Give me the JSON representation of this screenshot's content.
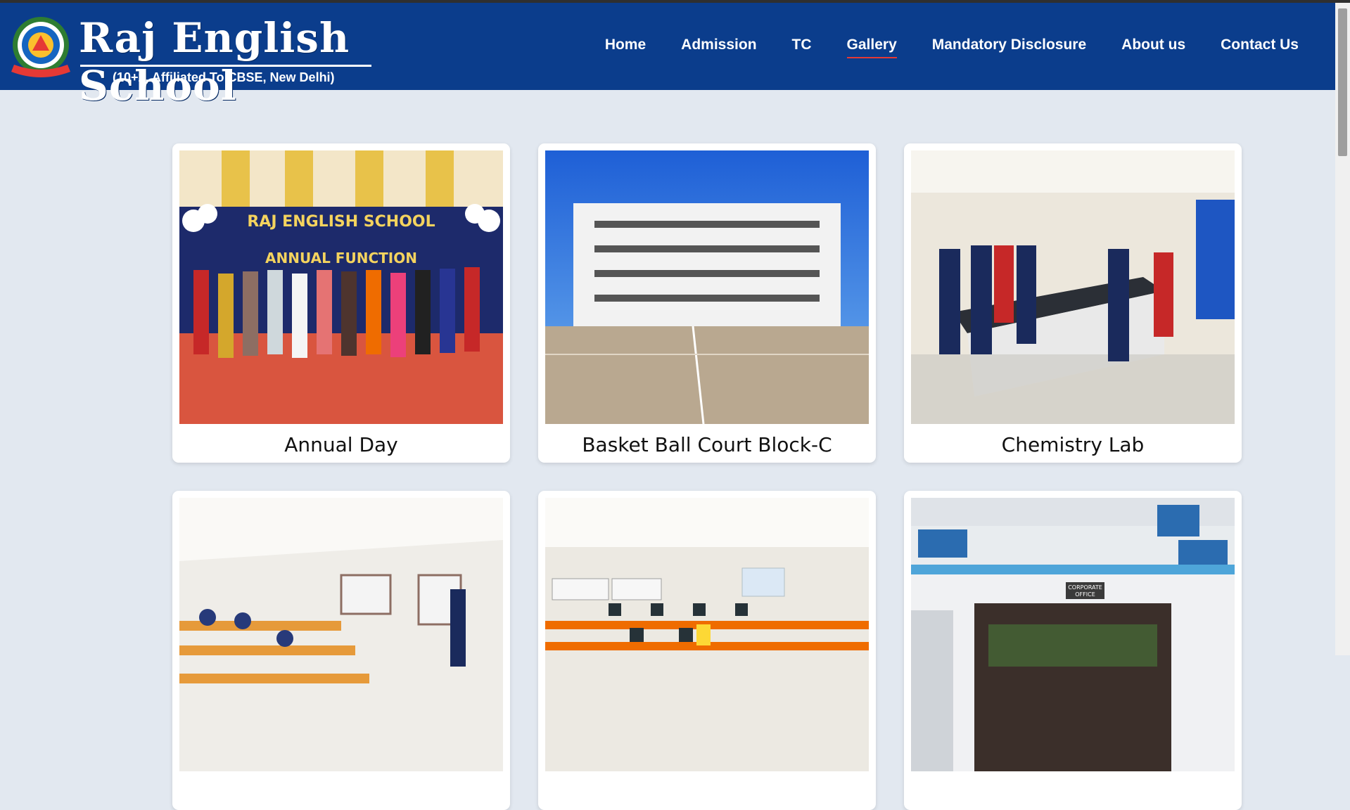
{
  "header": {
    "school_name": "Raj English School",
    "tagline": "(10+2, Affiliated To CBSE, New Delhi)",
    "logo_icon": "school-crest-icon",
    "background_color": "#0b3d8c"
  },
  "nav": {
    "items": [
      {
        "label": "Home"
      },
      {
        "label": "Admission"
      },
      {
        "label": "TC"
      },
      {
        "label": "Gallery",
        "active": true
      },
      {
        "label": "Mandatory Disclosure"
      },
      {
        "label": "About us"
      },
      {
        "label": "Contact Us"
      }
    ],
    "active_underline_color": "#e53935"
  },
  "gallery": {
    "items": [
      {
        "caption": "Annual Day",
        "banner_line1": "RAJ ENGLISH SCHOOL",
        "banner_line2": "ANNUAL FUNCTION"
      },
      {
        "caption": "Basket Ball Court Block-C"
      },
      {
        "caption": "Chemistry Lab"
      },
      {
        "caption": ""
      },
      {
        "caption": ""
      },
      {
        "caption": "",
        "sign_line1": "CORPORATE",
        "sign_line2": "OFFICE"
      }
    ]
  }
}
